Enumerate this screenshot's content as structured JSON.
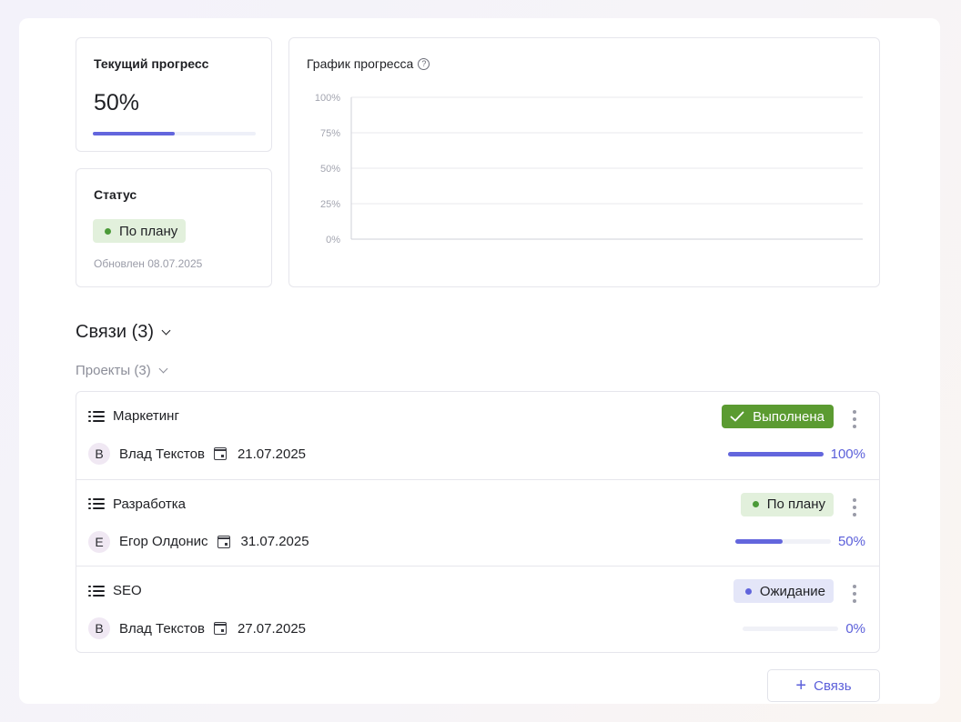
{
  "current_progress": {
    "title": "Текущий прогресс",
    "value": "50%",
    "fraction": 0.5
  },
  "status_card": {
    "title": "Статус",
    "badge": "По плану",
    "updated": "Обновлен 08.07.2025"
  },
  "chart_card": {
    "title": "График прогресса",
    "help_glyph": "?"
  },
  "chart_data": {
    "type": "line",
    "title": "График прогресса",
    "y_tick_labels": [
      "100%",
      "75%",
      "50%",
      "25%",
      "0%"
    ],
    "ylim": [
      0,
      100
    ],
    "grid": true,
    "series": []
  },
  "links_section": {
    "title": "Связи (3)",
    "projects_title": "Проекты (3)"
  },
  "projects": [
    {
      "name": "Маркетинг",
      "avatar": "В",
      "owner": "Влад Текстов",
      "date": "21.07.2025",
      "status": "Выполнена",
      "status_kind": "done",
      "progress": 1.0,
      "progress_label": "100%"
    },
    {
      "name": "Разработка",
      "avatar": "Е",
      "owner": "Егор Олдонис",
      "date": "31.07.2025",
      "status": "По плану",
      "status_kind": "on-track",
      "progress": 0.5,
      "progress_label": "50%"
    },
    {
      "name": "SEO",
      "avatar": "В",
      "owner": "Влад Текстов",
      "date": "27.07.2025",
      "status": "Ожидание",
      "status_kind": "waiting",
      "progress": 0.0,
      "progress_label": "0%"
    }
  ],
  "add_button": {
    "label": "Связь"
  },
  "colors": {
    "accent": "#6366dd",
    "done": "#5b9b31",
    "on_track_bg": "#e2f0dc",
    "waiting_bg": "#e4e6f8"
  }
}
